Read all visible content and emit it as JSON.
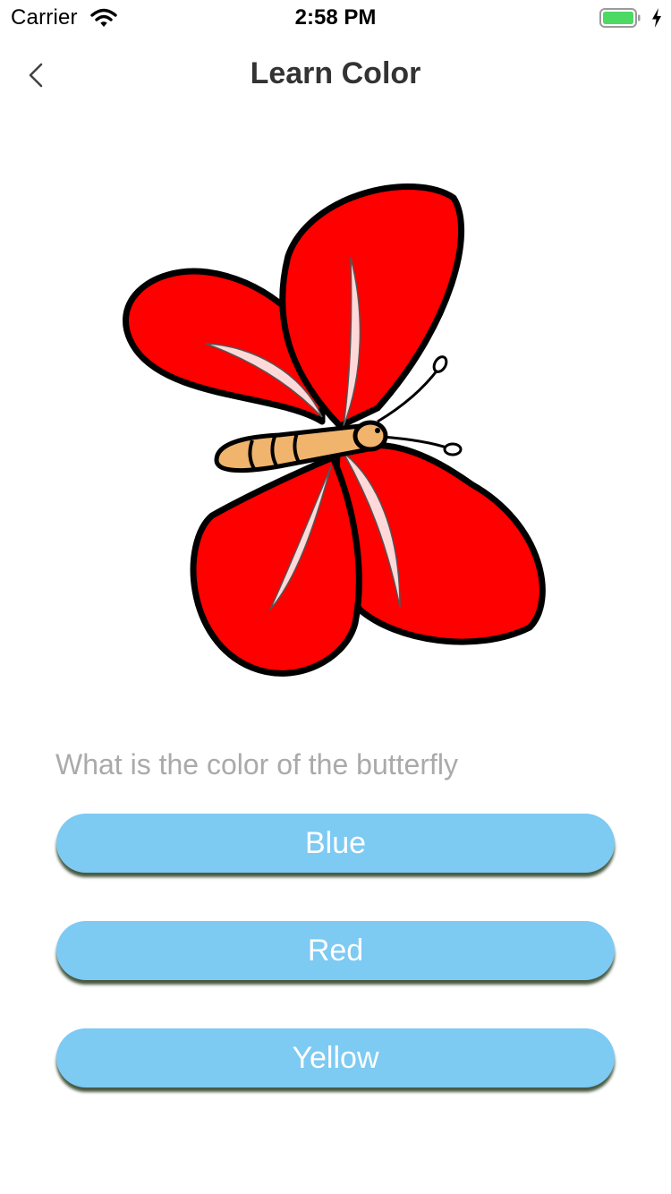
{
  "status_bar": {
    "carrier": "Carrier",
    "time": "2:58 PM",
    "icons": [
      "wifi-icon",
      "battery-icon",
      "charging-bolt-icon"
    ],
    "battery_color": "#4cd964"
  },
  "nav": {
    "back_icon": "chevron-left-icon",
    "title": "Learn Color"
  },
  "illustration": {
    "subject": "butterfly",
    "wing_color": "#ff0000",
    "body_color": "#f0b46c"
  },
  "quiz": {
    "question": "What is the color of the butterfly",
    "answers": [
      {
        "label": "Blue"
      },
      {
        "label": "Red"
      },
      {
        "label": "Yellow"
      }
    ],
    "button_color": "#7dcaf2"
  }
}
